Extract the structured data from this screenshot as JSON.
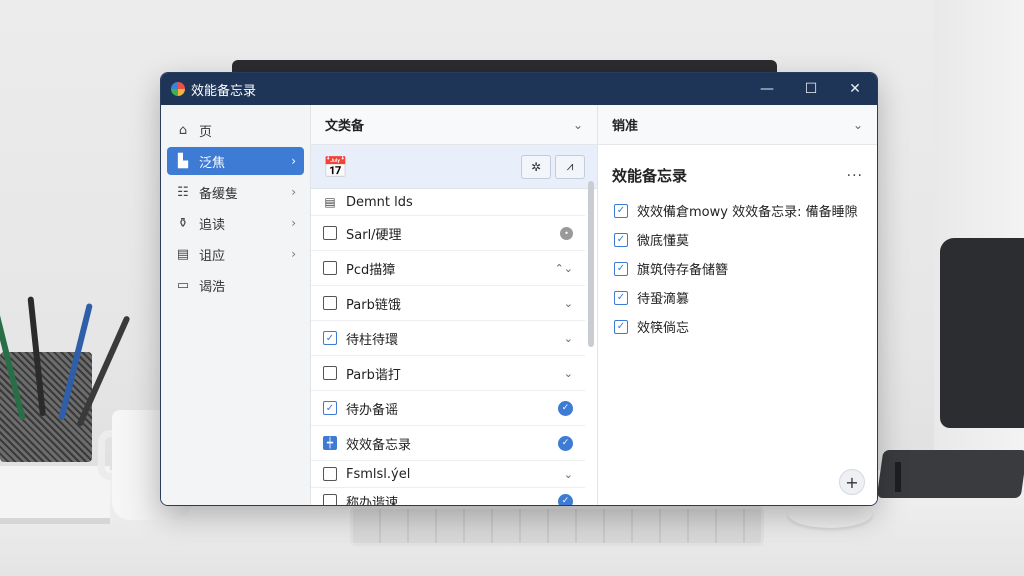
{
  "window": {
    "title": "效能备忘录",
    "controls": {
      "minimize": "—",
      "maximize": "☐",
      "close": "✕"
    }
  },
  "sidebar": {
    "items": [
      {
        "icon": "home-icon",
        "glyph": "⌂",
        "label": "页",
        "active": false,
        "chevron": ""
      },
      {
        "icon": "bookmark-icon",
        "glyph": "▙",
        "label": "泛焦",
        "active": true,
        "chevron": "›"
      },
      {
        "icon": "list-icon",
        "glyph": "☷",
        "label": "备缓隻",
        "active": false,
        "chevron": "›"
      },
      {
        "icon": "tag-icon",
        "glyph": "⚱",
        "label": "追读",
        "active": false,
        "chevron": "›"
      },
      {
        "icon": "folder-icon",
        "glyph": "▤",
        "label": "诅应",
        "active": false,
        "chevron": "›"
      },
      {
        "icon": "archive-icon",
        "glyph": "▭",
        "label": "谒浩",
        "active": false,
        "chevron": ""
      }
    ]
  },
  "middle": {
    "header": "文类备",
    "header_chevron": "⌄",
    "toolbar": {
      "calendar_icon": "📅",
      "btn1": "✲",
      "btn2": "⩘"
    },
    "tasks": [
      {
        "label": "Demnt lds",
        "state": "calendar",
        "end": "",
        "endType": "none",
        "small": true
      },
      {
        "label": "Sarl/硬理",
        "state": "unchecked",
        "end": "•",
        "endType": "grey"
      },
      {
        "label": "Pcd描獐",
        "state": "unchecked",
        "end": "⌃⌄",
        "endType": "text"
      },
      {
        "label": "Parb链饿",
        "state": "unchecked",
        "end": "⌄",
        "endType": "text"
      },
      {
        "label": "待柱待環",
        "state": "checked",
        "end": "⌄",
        "endType": "text"
      },
      {
        "label": "Parb谐打",
        "state": "unchecked",
        "end": "⌄",
        "endType": "text"
      },
      {
        "label": "待办备谣",
        "state": "checked",
        "end": "✓",
        "endType": "done"
      },
      {
        "label": "效效备忘录",
        "state": "filled",
        "end": "✓",
        "endType": "done"
      },
      {
        "label": "Fsmlsl.ýel",
        "state": "unchecked",
        "end": "⌄",
        "endType": "text",
        "small": true
      },
      {
        "label": "称办谐谏",
        "state": "unchecked",
        "end": "✓",
        "endType": "done",
        "small": true
      }
    ]
  },
  "right": {
    "header": "销准",
    "header_chevron": "⌄",
    "title": "效能备忘录",
    "more": "···",
    "items": [
      {
        "label": "效效備倉mowy 效效备忘录: 備备睡隙",
        "checked": true
      },
      {
        "label": "微底懂莫",
        "checked": true
      },
      {
        "label": "旗筑侍存备储簪",
        "checked": true
      },
      {
        "label": "待蛩滴篡",
        "checked": true
      },
      {
        "label": "效筷倘忘",
        "checked": true
      }
    ],
    "add_button": "+"
  }
}
